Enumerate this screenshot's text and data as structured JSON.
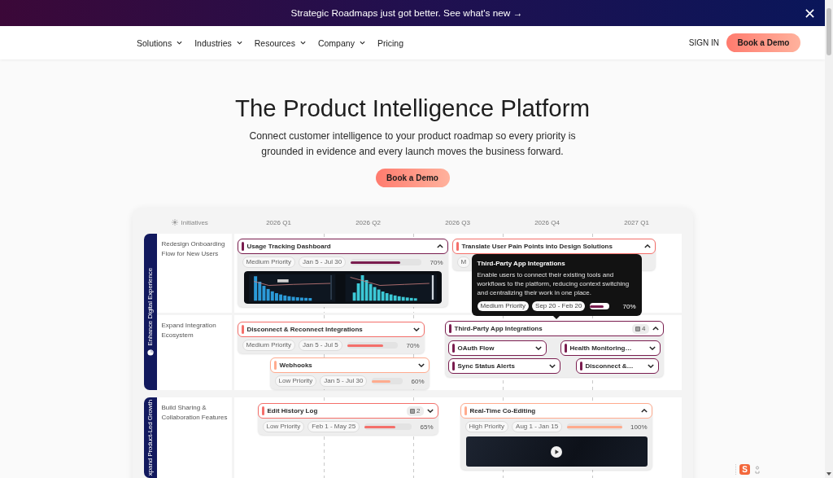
{
  "banner": {
    "text": "Strategic Roadmaps just got better. See what's new →"
  },
  "nav": {
    "menus": [
      {
        "label": "Solutions",
        "dropdown": true
      },
      {
        "label": "Industries",
        "dropdown": true
      },
      {
        "label": "Resources",
        "dropdown": true
      },
      {
        "label": "Company",
        "dropdown": true
      },
      {
        "label": "Pricing",
        "dropdown": false
      }
    ],
    "sign_in": "SIGN IN",
    "cta": "Book a Demo"
  },
  "hero": {
    "title": "The Product Intelligence Platform",
    "subtitle": "Connect customer intelligence to your product roadmap so every priority is grounded in evidence and every launch moves the business forward.",
    "cta": "Book a Demo"
  },
  "roadmap": {
    "header_label": "Initiatives",
    "quarters": [
      "2026 Q1",
      "2026 Q2",
      "2026 Q3",
      "2026 Q4",
      "2027 Q1"
    ],
    "groups": [
      {
        "name": "Enhance Digital Experience",
        "rows": [
          {
            "label": "Redesign Onboarding Flow for New Users",
            "items": [
              {
                "title": "Usage Tracking Dashboard",
                "color": "#7a1d4f",
                "expanded": true,
                "priority": "Medium Priority",
                "dates": "Jan 5 - Jul 30",
                "level": 0.7,
                "percent": "70%",
                "preview": {
                  "kind": "dashboard"
                }
              },
              {
                "title": "Translate User Pain Points into Design Solutions",
                "color": "#f46f6a",
                "expanded": true,
                "priority": "M"
              }
            ]
          },
          {
            "label": "Expand Integration Ecosystem",
            "items": [
              {
                "title": "Disconnect & Reconnect Integrations",
                "color": "#f46f6a",
                "expanded": false,
                "priority": "Medium Priority",
                "dates": "Jan 5 - Jul 5",
                "level": 0.7,
                "percent": "70%"
              },
              {
                "title": "Webhooks",
                "color": "#ffab8e",
                "expanded": false,
                "priority": "Low Priority",
                "dates": "Jan 5 - Jul 30",
                "level": 0.6,
                "percent": "60%"
              },
              {
                "title": "Third-Party App Integrations",
                "color": "#7a1d4f",
                "expanded": true,
                "count": "4",
                "children": [
                  {
                    "title": "OAuth Flow",
                    "color": "#7a1d4f",
                    "expanded": false
                  },
                  {
                    "title": "Health Monitoring…",
                    "color": "#7a1d4f",
                    "expanded": false
                  },
                  {
                    "title": "Sync Status Alerts",
                    "color": "#7a1d4f",
                    "expanded": false
                  },
                  {
                    "title": "Disconnect &…",
                    "color": "#7a1d4f",
                    "expanded": false
                  }
                ]
              }
            ]
          }
        ]
      },
      {
        "name": "xpand Product-Led Growth",
        "rows": [
          {
            "label": "Build Sharing & Collaboration Features",
            "items": [
              {
                "title": "Edit History Log",
                "color": "#f46f6a",
                "expanded": false,
                "count": "2",
                "priority": "Low Priority",
                "dates": "Feb 1 - May 25",
                "level": 0.65,
                "percent": "65%"
              },
              {
                "title": "Real-Time Co-Editing",
                "color": "#ffab8e",
                "expanded": true,
                "priority": "High Priority",
                "dates": "Aug 1 - Jan 15",
                "level": 1,
                "percent": "100%",
                "preview": {
                  "kind": "video"
                }
              }
            ]
          }
        ]
      }
    ],
    "tooltip": {
      "title": "Third-Party App Integrations",
      "description": "Enable users to connect their existing tools and workflows to the platform, reducing context switching and centralizing their work in one place.",
      "priority": "Medium Priority",
      "dates": "Sep 20 - Feb 20",
      "level": 0.7,
      "percent": "70%"
    }
  },
  "floating_widget": {
    "logo": "S"
  }
}
